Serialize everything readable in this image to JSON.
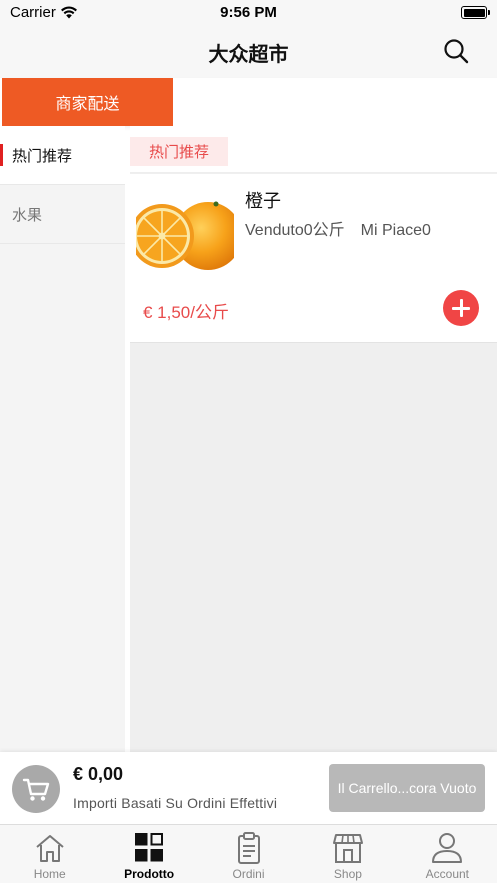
{
  "status_bar": {
    "carrier": "Carrier",
    "time": "9:56 PM",
    "icons": [
      "wifi-icon",
      "battery-icon"
    ]
  },
  "nav": {
    "title": "大众超市",
    "search_icon": "search-icon"
  },
  "delivery_tab": {
    "label": "商家配送",
    "accent_color": "#ee5a24"
  },
  "sidebar": {
    "items": [
      {
        "label": "热门推荐",
        "active": true
      },
      {
        "label": "水果",
        "active": false
      }
    ]
  },
  "section": {
    "tag": "热门推荐"
  },
  "products": [
    {
      "name": "橙子",
      "sold": "Venduto0公斤",
      "likes": "Mi Piace0",
      "price": "€ 1,50/公斤",
      "image_icon": "orange-product-image",
      "add_icon": "plus-icon"
    }
  ],
  "cart": {
    "total": "€ 0,00",
    "note": "Importi Basati Su Ordini Effettivi",
    "checkout_label": "Il Carrello...cora Vuoto",
    "cart_icon": "shopping-cart-icon"
  },
  "tab_bar": {
    "items": [
      {
        "label": "Home",
        "icon": "home-icon",
        "active": false
      },
      {
        "label": "Prodotto",
        "icon": "grid-icon",
        "active": true
      },
      {
        "label": "Ordini",
        "icon": "clipboard-icon",
        "active": false
      },
      {
        "label": "Shop",
        "icon": "store-icon",
        "active": false
      },
      {
        "label": "Account",
        "icon": "user-icon",
        "active": false
      }
    ]
  },
  "colors": {
    "accent_orange": "#ee5a24",
    "price_red": "#e84b4b",
    "add_button_red": "#f04545",
    "checkout_disabled": "#b8b8b8"
  }
}
